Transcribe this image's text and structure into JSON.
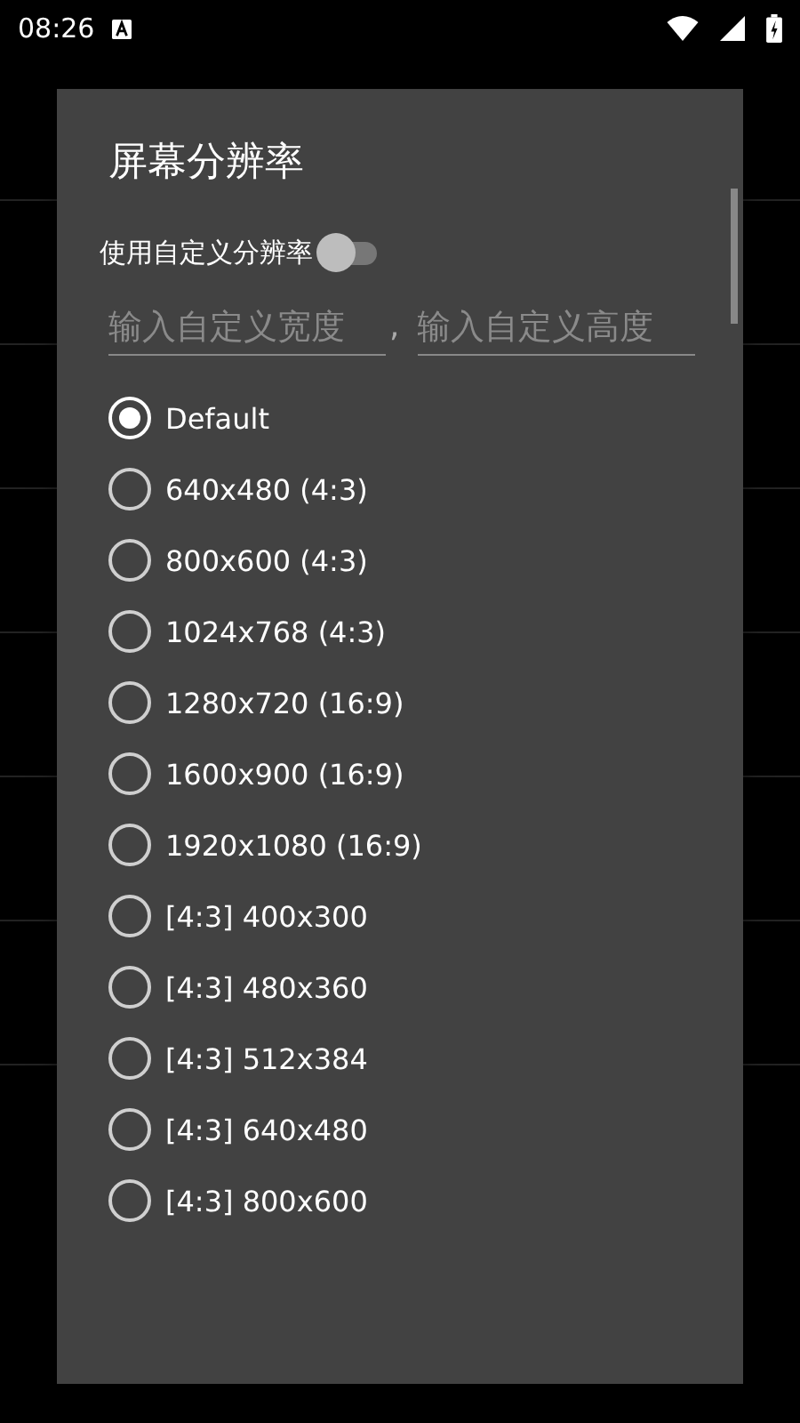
{
  "status_bar": {
    "time": "08:26"
  },
  "dialog": {
    "title": "屏幕分辨率",
    "custom_switch": {
      "label": "使用自定义分辨率",
      "on": false
    },
    "width_field": {
      "placeholder": "输入自定义宽度"
    },
    "separator": ",",
    "height_field": {
      "placeholder": "输入自定义高度"
    },
    "options": [
      {
        "label": "Default",
        "selected": true
      },
      {
        "label": "640x480 (4:3)",
        "selected": false
      },
      {
        "label": "800x600 (4:3)",
        "selected": false
      },
      {
        "label": "1024x768 (4:3)",
        "selected": false
      },
      {
        "label": "1280x720 (16:9)",
        "selected": false
      },
      {
        "label": "1600x900 (16:9)",
        "selected": false
      },
      {
        "label": "1920x1080 (16:9)",
        "selected": false
      },
      {
        "label": "[4:3] 400x300",
        "selected": false
      },
      {
        "label": "[4:3] 480x360",
        "selected": false
      },
      {
        "label": "[4:3] 512x384",
        "selected": false
      },
      {
        "label": "[4:3] 640x480",
        "selected": false
      },
      {
        "label": "[4:3] 800x600",
        "selected": false
      }
    ]
  }
}
